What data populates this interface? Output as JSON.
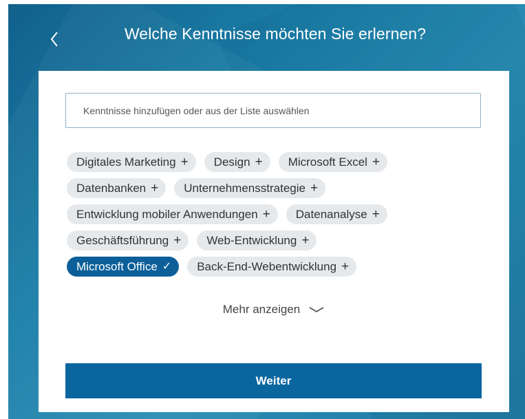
{
  "header": {
    "title": "Welche Kenntnisse möchten Sie erlernen?",
    "back_icon": "chevron-left-icon"
  },
  "search": {
    "placeholder": "Kenntnisse hinzufügen oder aus der Liste auswählen",
    "value": ""
  },
  "skills": [
    {
      "label": "Digitales Marketing",
      "selected": false
    },
    {
      "label": "Design",
      "selected": false
    },
    {
      "label": "Microsoft Excel",
      "selected": false
    },
    {
      "label": "Datenbanken",
      "selected": false
    },
    {
      "label": "Unternehmensstrategie",
      "selected": false
    },
    {
      "label": "Entwicklung mobiler Anwendungen",
      "selected": false
    },
    {
      "label": "Datenanalyse",
      "selected": false
    },
    {
      "label": "Geschäftsführung",
      "selected": false
    },
    {
      "label": "Web-Entwicklung",
      "selected": false
    },
    {
      "label": "Microsoft Office",
      "selected": true
    },
    {
      "label": "Back-End-Webentwicklung",
      "selected": false
    }
  ],
  "icons": {
    "add": "+",
    "selected": "✓"
  },
  "more": {
    "label": "Mehr anzeigen"
  },
  "submit": {
    "label": "Weiter"
  },
  "colors": {
    "background": "#1b7fa8",
    "primary": "#0b66a0",
    "pill": "#e6e9ec",
    "pill_selected": "#0c5f99"
  }
}
